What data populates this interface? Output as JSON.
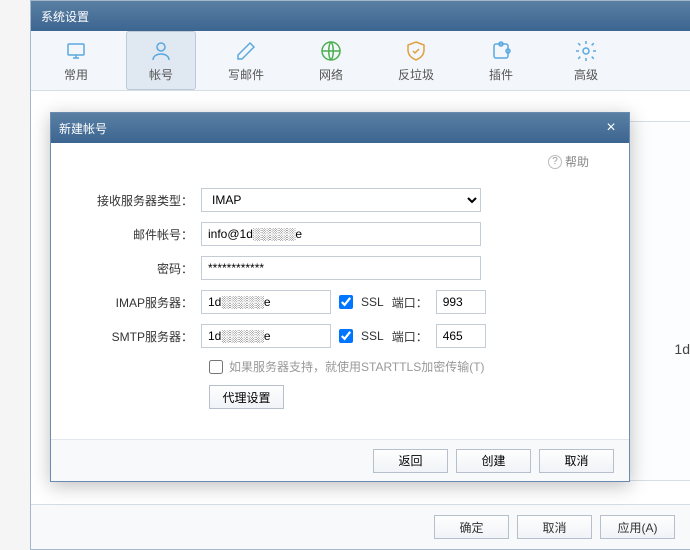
{
  "mainWindow": {
    "title": "系统设置"
  },
  "tabs": [
    {
      "label": "常用"
    },
    {
      "label": "帐号"
    },
    {
      "label": "写邮件"
    },
    {
      "label": "网络"
    },
    {
      "label": "反垃圾"
    },
    {
      "label": "插件"
    },
    {
      "label": "高级"
    }
  ],
  "footerButtons": {
    "ok": "确定",
    "cancel": "取消",
    "apply": "应用(A)"
  },
  "dialog": {
    "title": "新建帐号",
    "help": "帮助",
    "labels": {
      "serverType": "接收服务器类型：",
      "email": "邮件帐号：",
      "password": "密码：",
      "imap": "IMAP服务器：",
      "smtp": "SMTP服务器：",
      "ssl": "SSL",
      "port": "端口：",
      "starttls": "如果服务器支持，就使用STARTTLS加密传输(T)",
      "proxy": "代理设置"
    },
    "values": {
      "serverType": "IMAP",
      "email": "info@1d░░░░░e",
      "password": "************",
      "imapServer": "1d░░░░░e",
      "smtpServer": "1d░░░░░e",
      "imapPort": "993",
      "smtpPort": "465"
    },
    "buttons": {
      "back": "返回",
      "create": "创建",
      "cancel": "取消"
    }
  },
  "bgEdge": "1d"
}
